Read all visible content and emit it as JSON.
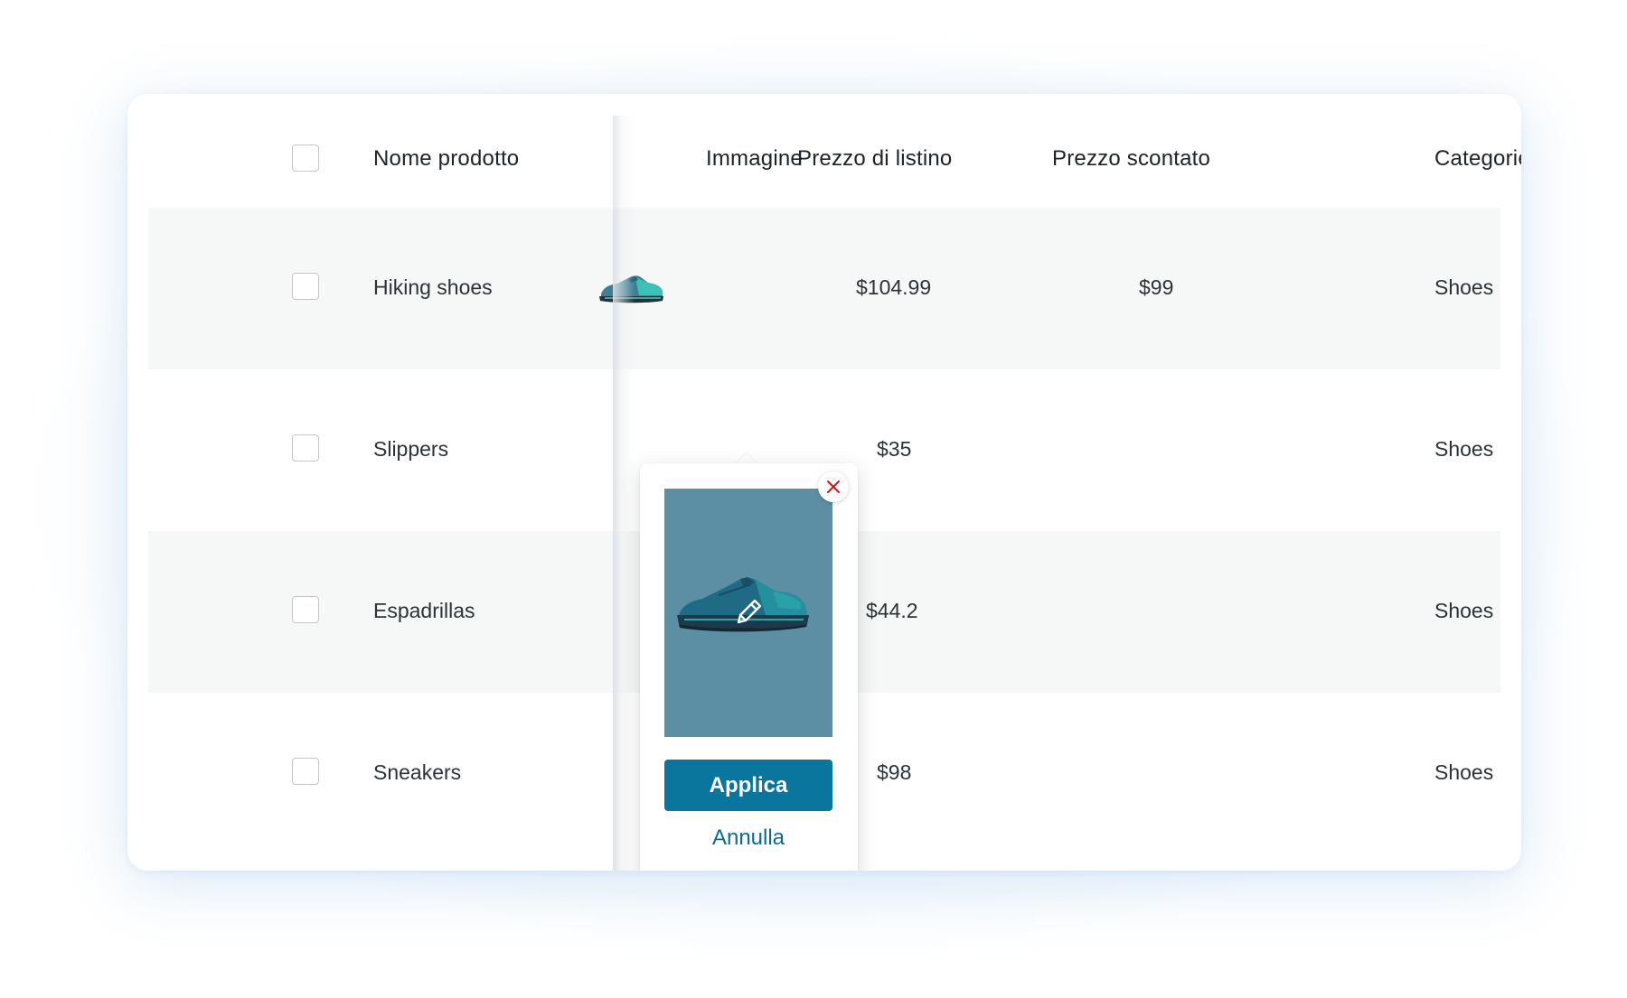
{
  "table": {
    "columns": {
      "name": "Nome prodotto",
      "image": "Immagine",
      "list_price": "Prezzo di listino",
      "sale_price": "Prezzo scontato",
      "categories": "Categorie"
    },
    "rows": [
      {
        "name": "Hiking shoes",
        "list_price": "$104.99",
        "sale_price": "$99",
        "category": "Shoes",
        "image_icon": "sneaker-thumbnail",
        "shaded": true
      },
      {
        "name": "Slippers",
        "list_price": "$35",
        "sale_price": "",
        "category": "Shoes",
        "shaded": false
      },
      {
        "name": "Espadrillas",
        "list_price": "$44.2",
        "sale_price": "",
        "category": "Shoes",
        "shaded": true
      },
      {
        "name": "Sneakers",
        "list_price": "$98",
        "sale_price": "",
        "category": "Shoes",
        "shaded": false
      }
    ]
  },
  "image_popover": {
    "apply_label": "Applica",
    "cancel_label": "Annulla",
    "preview_icon": "sneaker-image",
    "edit_icon": "pencil-icon",
    "close_icon": "close-icon"
  },
  "colors": {
    "primary_button": "#0a769e",
    "link": "#0a6a93",
    "close_x": "#cc1818",
    "row_shade": "#f6f7f7",
    "preview_bg": "#5c8fa4"
  }
}
